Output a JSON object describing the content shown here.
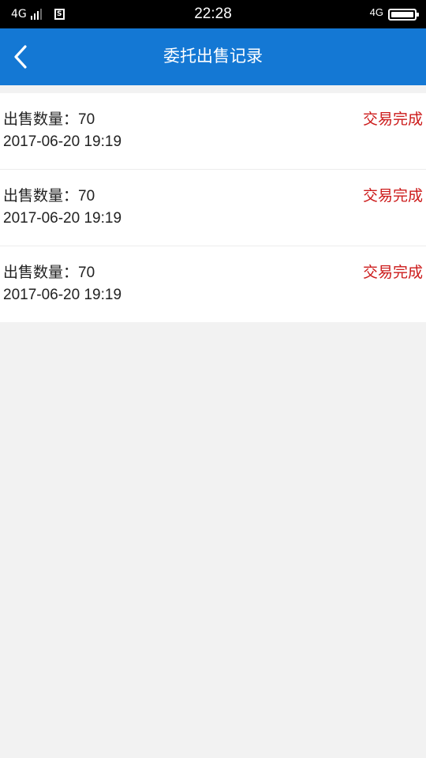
{
  "status_bar": {
    "network_left": "4G",
    "sim_label": "S",
    "time": "22:28",
    "network_right": "4G",
    "battery_level": 1.0
  },
  "header": {
    "back_icon": "chevron-left-icon",
    "title": "委托出售记录"
  },
  "colors": {
    "header_bg": "#1478d4",
    "status_text": "#cc1a1a",
    "page_bg": "#f2f2f2"
  },
  "records": [
    {
      "qty_label": "出售数量：",
      "qty_value": "70",
      "date": "2017-06-20 19:19",
      "status": "交易完成"
    },
    {
      "qty_label": "出售数量：",
      "qty_value": "70",
      "date": "2017-06-20 19:19",
      "status": "交易完成"
    },
    {
      "qty_label": "出售数量：",
      "qty_value": "70",
      "date": "2017-06-20 19:19",
      "status": "交易完成"
    }
  ]
}
